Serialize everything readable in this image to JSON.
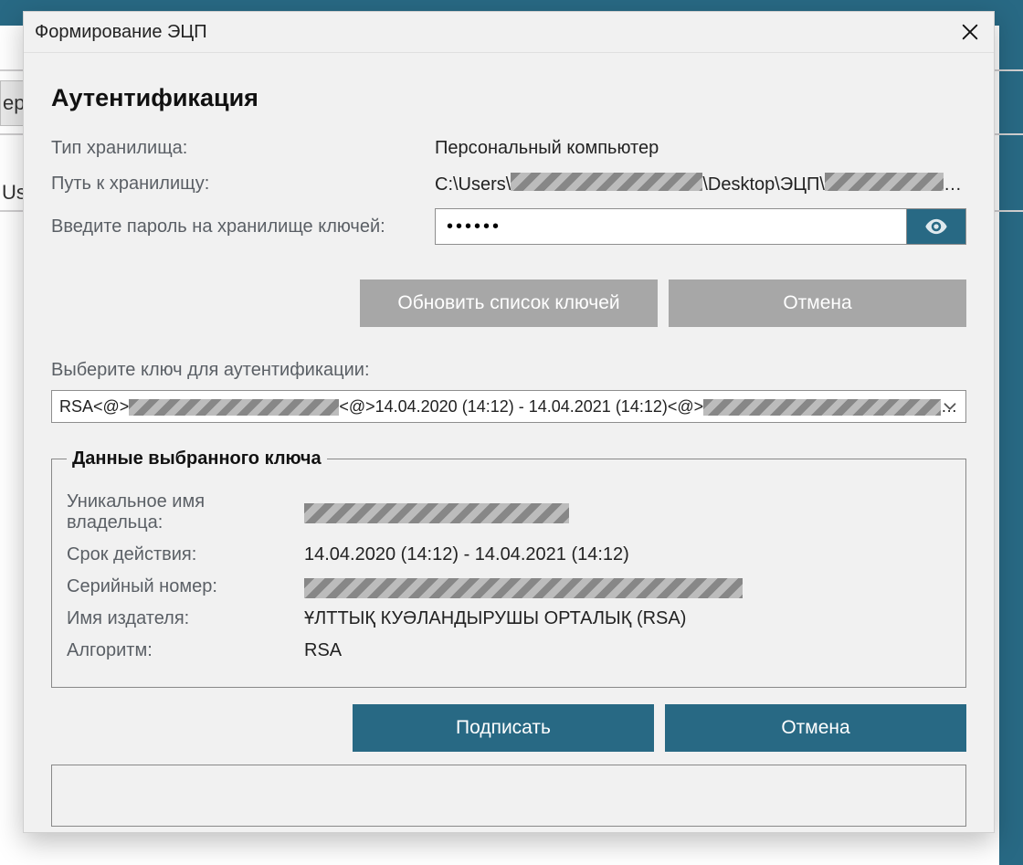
{
  "background": {
    "tab_text": "ер",
    "side_label": "Us"
  },
  "dialog": {
    "window_title": "Формирование ЭЦП",
    "heading": "Аутентификация",
    "labels": {
      "storage_type": "Тип хранилища:",
      "storage_path": "Путь к хранилищу:",
      "password_prompt": "Введите пароль на хранилище ключей:",
      "select_key": "Выберите ключ для аутентификации:"
    },
    "values": {
      "storage_type": "Персональный компьютер",
      "path_prefix": "C:\\Users\\",
      "path_middle": "\\Desktop\\ЭЦП\\",
      "path_suffix": "…",
      "password_masked": "●●●●●●"
    },
    "buttons": {
      "refresh": "Обновить список ключей",
      "cancel1": "Отмена",
      "sign": "Подписать",
      "cancel2": "Отмена"
    },
    "select": {
      "prefix": "RSA<@>",
      "mid1": "<@>14.04.2020 (14:12) - 14.04.2021 (14:12)<@>",
      "suffix": "…"
    },
    "details": {
      "legend": "Данные выбранного ключа",
      "rows": {
        "owner_label": "Уникальное имя владельца:",
        "validity_label": "Срок действия:",
        "validity_value": "14.04.2020 (14:12) - 14.04.2021 (14:12)",
        "serial_label": "Серийный номер:",
        "issuer_label": "Имя издателя:",
        "issuer_value": "ҰЛТТЫҚ КУӘЛАНДЫРУШЫ ОРТАЛЫҚ (RSA)",
        "algo_label": "Алгоритм:",
        "algo_value": "RSA"
      }
    }
  }
}
